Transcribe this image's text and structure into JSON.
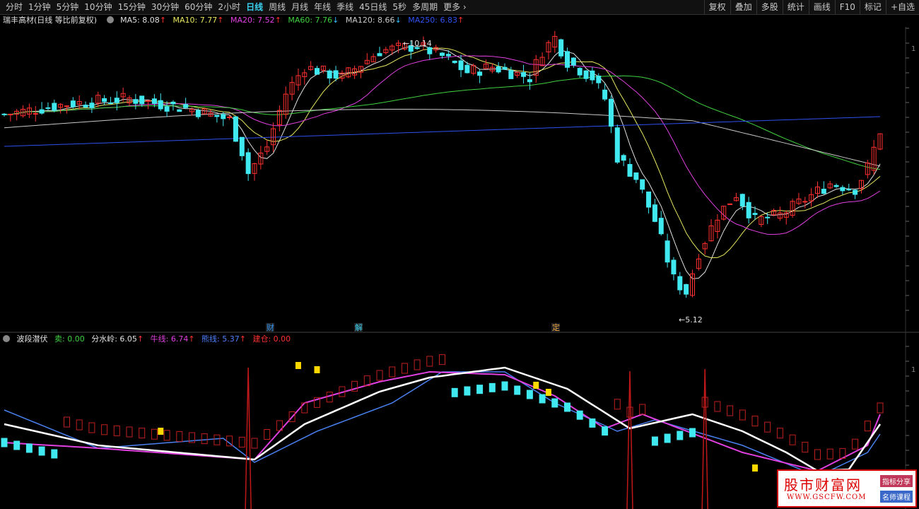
{
  "toolbar": {
    "tabs": [
      "分时",
      "1分钟",
      "5分钟",
      "10分钟",
      "15分钟",
      "30分钟",
      "60分钟",
      "2小时",
      "日线",
      "周线",
      "月线",
      "年线",
      "季线",
      "45日线",
      "5秒",
      "多周期",
      "更多"
    ],
    "active": "日线",
    "right": [
      "复权",
      "叠加",
      "多股",
      "统计",
      "画线",
      "F10",
      "标记",
      "+自选"
    ]
  },
  "info": {
    "stock": "瑞丰高材(日线 等比前复权)",
    "ma5": "MA5: 8.08",
    "ma10": "MA10: 7.77",
    "ma20": "MA20: 7.52",
    "ma60": "MA60: 7.76",
    "ma120": "MA120: 8.66",
    "ma250": "MA250: 6.83"
  },
  "markers": {
    "high": "10.14",
    "low": "5.12",
    "events": [
      "财",
      "解",
      "定"
    ]
  },
  "indicator": {
    "name": "波段潜伏",
    "sell": "卖: 0.00",
    "fsl": "分水岭: 6.05",
    "niu": "牛线: 6.74",
    "xiong": "熊线: 5.37",
    "jian": "建仓: 0.00"
  },
  "watermark": {
    "title": "股市财富网",
    "url": "WWW.GSCFW.COM",
    "tag1": "指标分享",
    "tag2": "名师课程"
  },
  "colors": {
    "up": "#ff3030",
    "down": "#40e8f0",
    "ma5": "#e0e0e0",
    "ma10": "#e8e860",
    "ma20": "#e040e0",
    "ma60": "#40d040",
    "ma120": "#c8c8c8",
    "ma250": "#3050f0"
  },
  "chart_data": {
    "type": "candlestick",
    "title": "瑞丰高材",
    "price_high": 10.14,
    "price_low": 5.12,
    "latest_ma": {
      "MA5": 8.08,
      "MA10": 7.77,
      "MA20": 7.52,
      "MA60": 7.76,
      "MA120": 8.66,
      "MA250": 6.83
    },
    "indicator": {
      "name": "波段潜伏",
      "卖": 0.0,
      "分水岭": 6.05,
      "牛线": 6.74,
      "熊线": 5.37,
      "建仓": 0.0
    }
  }
}
